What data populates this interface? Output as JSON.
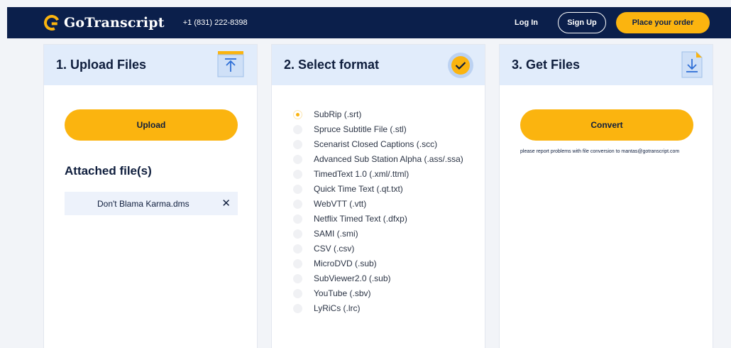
{
  "header": {
    "brand": "GoTranscript",
    "phone": "+1 (831) 222-8398",
    "login_label": "Log In",
    "signup_label": "Sign Up",
    "order_label": "Place your order",
    "colors": {
      "navy": "#0b1f4b",
      "accent": "#fbb40f"
    }
  },
  "upload_card": {
    "title": "1. Upload Files",
    "icon": "upload-icon",
    "upload_label": "Upload",
    "attached_title": "Attached file(s)",
    "files": [
      {
        "name": "Don't Blama Karma.dms",
        "remove_icon": "close-icon"
      }
    ]
  },
  "format_card": {
    "title": "2. Select format",
    "icon": "check-icon",
    "selected": "SubRip (.srt)",
    "formats": [
      "SubRip (.srt)",
      "Spruce Subtitle File (.stl)",
      "Scenarist Closed Captions (.scc)",
      "Advanced Sub Station Alpha (.ass/.ssa)",
      "TimedText 1.0 (.xml/.ttml)",
      "Quick Time Text (.qt.txt)",
      "WebVTT (.vtt)",
      "Netflix Timed Text (.dfxp)",
      "SAMI (.smi)",
      "CSV (.csv)",
      "MicroDVD (.sub)",
      "SubViewer2.0 (.sub)",
      "YouTube (.sbv)",
      "LyRiCs (.lrc)"
    ]
  },
  "files_card": {
    "title": "3. Get Files",
    "icon": "download-icon",
    "convert_label": "Convert",
    "note": "please report problems with file conversion to mantas@gotranscript.com"
  }
}
